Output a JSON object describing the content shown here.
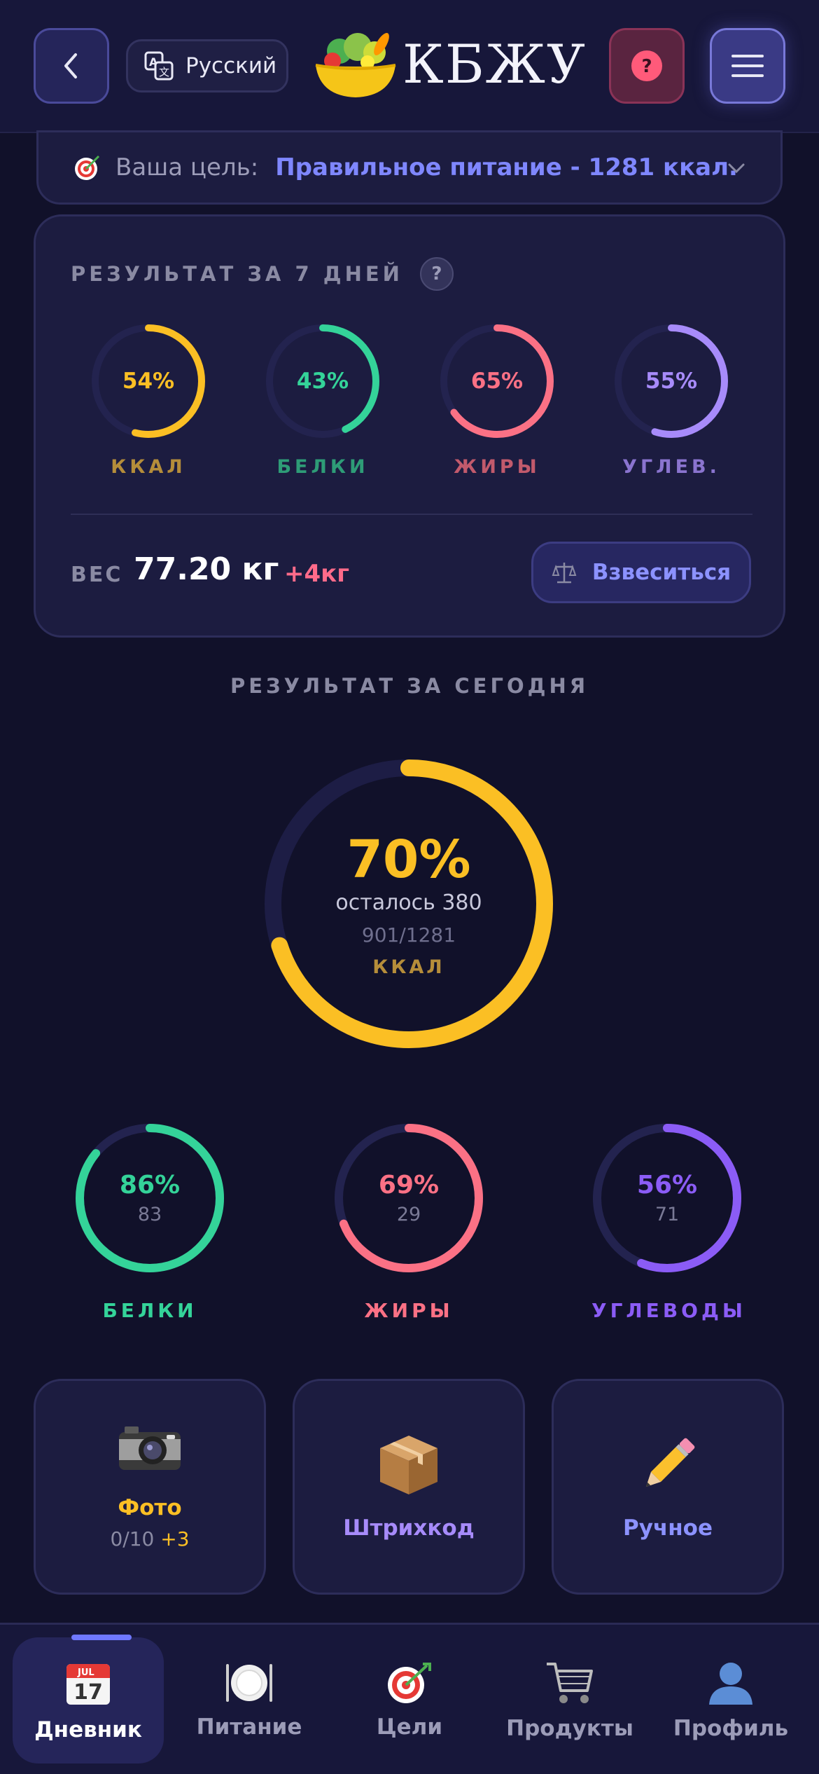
{
  "header": {
    "language": "Русский",
    "logo_text": "КБЖУ"
  },
  "goal": {
    "label": "Ваша цель:",
    "value": "Правильное питание - 1281 ккал."
  },
  "week": {
    "title": "РЕЗУЛЬТАТ ЗА 7 ДНЕЙ",
    "help": "?",
    "rings": [
      {
        "pct_text": "54%",
        "pct": 54,
        "label": "ККАЛ",
        "color": "#fbbf24",
        "label_color": "#b58d3a"
      },
      {
        "pct_text": "43%",
        "pct": 43,
        "label": "БЕЛКИ",
        "color": "#34d399",
        "label_color": "#2e9c77"
      },
      {
        "pct_text": "65%",
        "pct": 65,
        "label": "ЖИРЫ",
        "color": "#fb7185",
        "label_color": "#c25a6c"
      },
      {
        "pct_text": "55%",
        "pct": 55,
        "label": "УГЛЕВ.",
        "color": "#a78bfa",
        "label_color": "#8a74cf"
      }
    ],
    "weight_label": "ВЕС",
    "weight_value": "77.20 кг",
    "weight_delta": "+4кг",
    "weigh_button": "Взвеситься"
  },
  "today": {
    "title": "РЕЗУЛЬТАТ ЗА СЕГОДНЯ",
    "main": {
      "pct_text": "70%",
      "pct": 70,
      "remaining": "осталось 380",
      "progress": "901/1281",
      "unit": "ККАЛ",
      "color": "#fbbf24"
    },
    "macros": [
      {
        "pct_text": "86%",
        "pct": 86,
        "amount": "83",
        "label": "БЕЛКИ",
        "color": "#34d399",
        "label_color": "#34d399"
      },
      {
        "pct_text": "69%",
        "pct": 69,
        "amount": "29",
        "label": "ЖИРЫ",
        "color": "#fb7185",
        "label_color": "#fb7185"
      },
      {
        "pct_text": "56%",
        "pct": 56,
        "amount": "71",
        "label": "УГЛЕВОДЫ",
        "color": "#8b5cf6",
        "label_color": "#8b5cf6"
      }
    ]
  },
  "actions": {
    "photo": {
      "label": "Фото",
      "count": "0/10",
      "bonus": "+3"
    },
    "barcode": {
      "label": "Штрихкод"
    },
    "manual": {
      "label": "Ручное"
    }
  },
  "tabs": {
    "diary": "Дневник",
    "food": "Питание",
    "goals": "Цели",
    "products": "Продукты",
    "profile": "Профиль",
    "calendar_month": "JUL",
    "calendar_day": "17"
  },
  "colors": {
    "background": "#11112a",
    "card": "#1c1c40",
    "accent": "#7f87ff"
  }
}
